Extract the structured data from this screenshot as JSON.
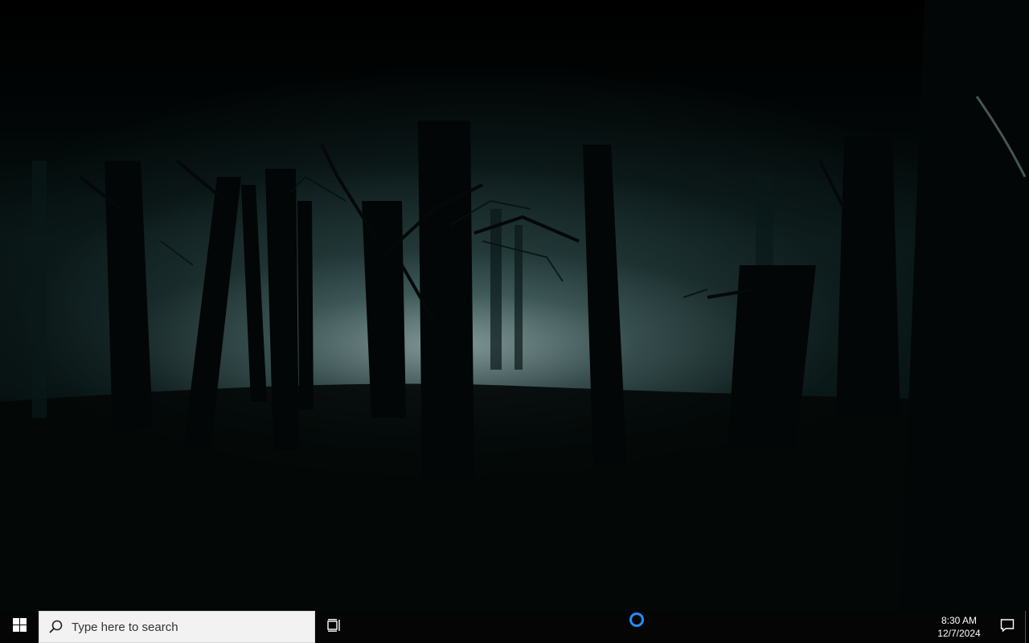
{
  "desktop": {
    "wallpaper": "dark-foggy-forest"
  },
  "taskbar": {
    "start_icon": "windows-logo-icon",
    "search": {
      "icon": "search-icon",
      "placeholder": "Type here to search"
    },
    "task_view_icon": "task-view-icon",
    "cortana_icon": "cortana-ring-icon",
    "clock": {
      "time": "8:30 AM",
      "date": "12/7/2024"
    },
    "notification_icon": "action-center-icon"
  },
  "colors": {
    "taskbar_bg": "#050505",
    "search_bg": "#f2f2f2",
    "cortana_ring": "#1e90ff",
    "text_light": "#ffffff"
  }
}
